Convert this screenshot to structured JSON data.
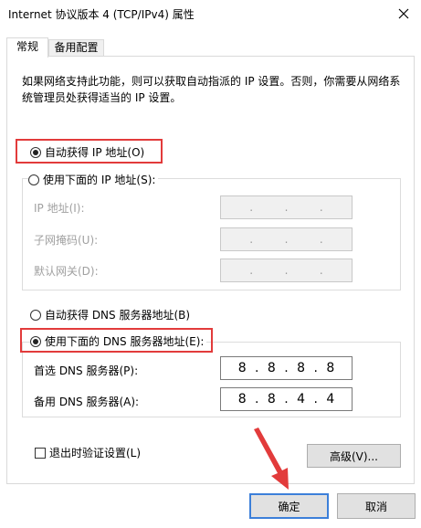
{
  "window": {
    "title": "Internet 协议版本 4 (TCP/IPv4) 属性"
  },
  "tabs": [
    {
      "label": "常规",
      "active": true
    },
    {
      "label": "备用配置",
      "active": false
    }
  ],
  "description": "如果网络支持此功能，则可以获取自动指派的 IP 设置。否则，你需要从网络系统管理员处获得适当的 IP 设置。",
  "ip_section": {
    "auto_option": {
      "label": "自动获得 IP 地址(O)",
      "checked": true
    },
    "manual_option": {
      "label": "使用下面的 IP 地址(S):",
      "checked": false
    },
    "fields": [
      {
        "label": "IP 地址(I):",
        "value": [
          "",
          "",
          "",
          ""
        ]
      },
      {
        "label": "子网掩码(U):",
        "value": [
          "",
          "",
          "",
          ""
        ]
      },
      {
        "label": "默认网关(D):",
        "value": [
          "",
          "",
          "",
          ""
        ]
      }
    ]
  },
  "dns_section": {
    "auto_option": {
      "label": "自动获得 DNS 服务器地址(B)",
      "checked": false
    },
    "manual_option": {
      "label": "使用下面的 DNS 服务器地址(E):",
      "checked": true
    },
    "fields": [
      {
        "label": "首选 DNS 服务器(P):",
        "octets": [
          "8",
          "8",
          "8",
          "8"
        ]
      },
      {
        "label": "备用 DNS 服务器(A):",
        "octets": [
          "8",
          "8",
          "4",
          "4"
        ]
      }
    ]
  },
  "validate_checkbox": {
    "label": "退出时验证设置(L)",
    "checked": false
  },
  "buttons": {
    "advanced": "高级(V)...",
    "ok": "确定",
    "cancel": "取消"
  },
  "colors": {
    "highlight": "#e23b3b",
    "accent": "#3c7fd9"
  }
}
